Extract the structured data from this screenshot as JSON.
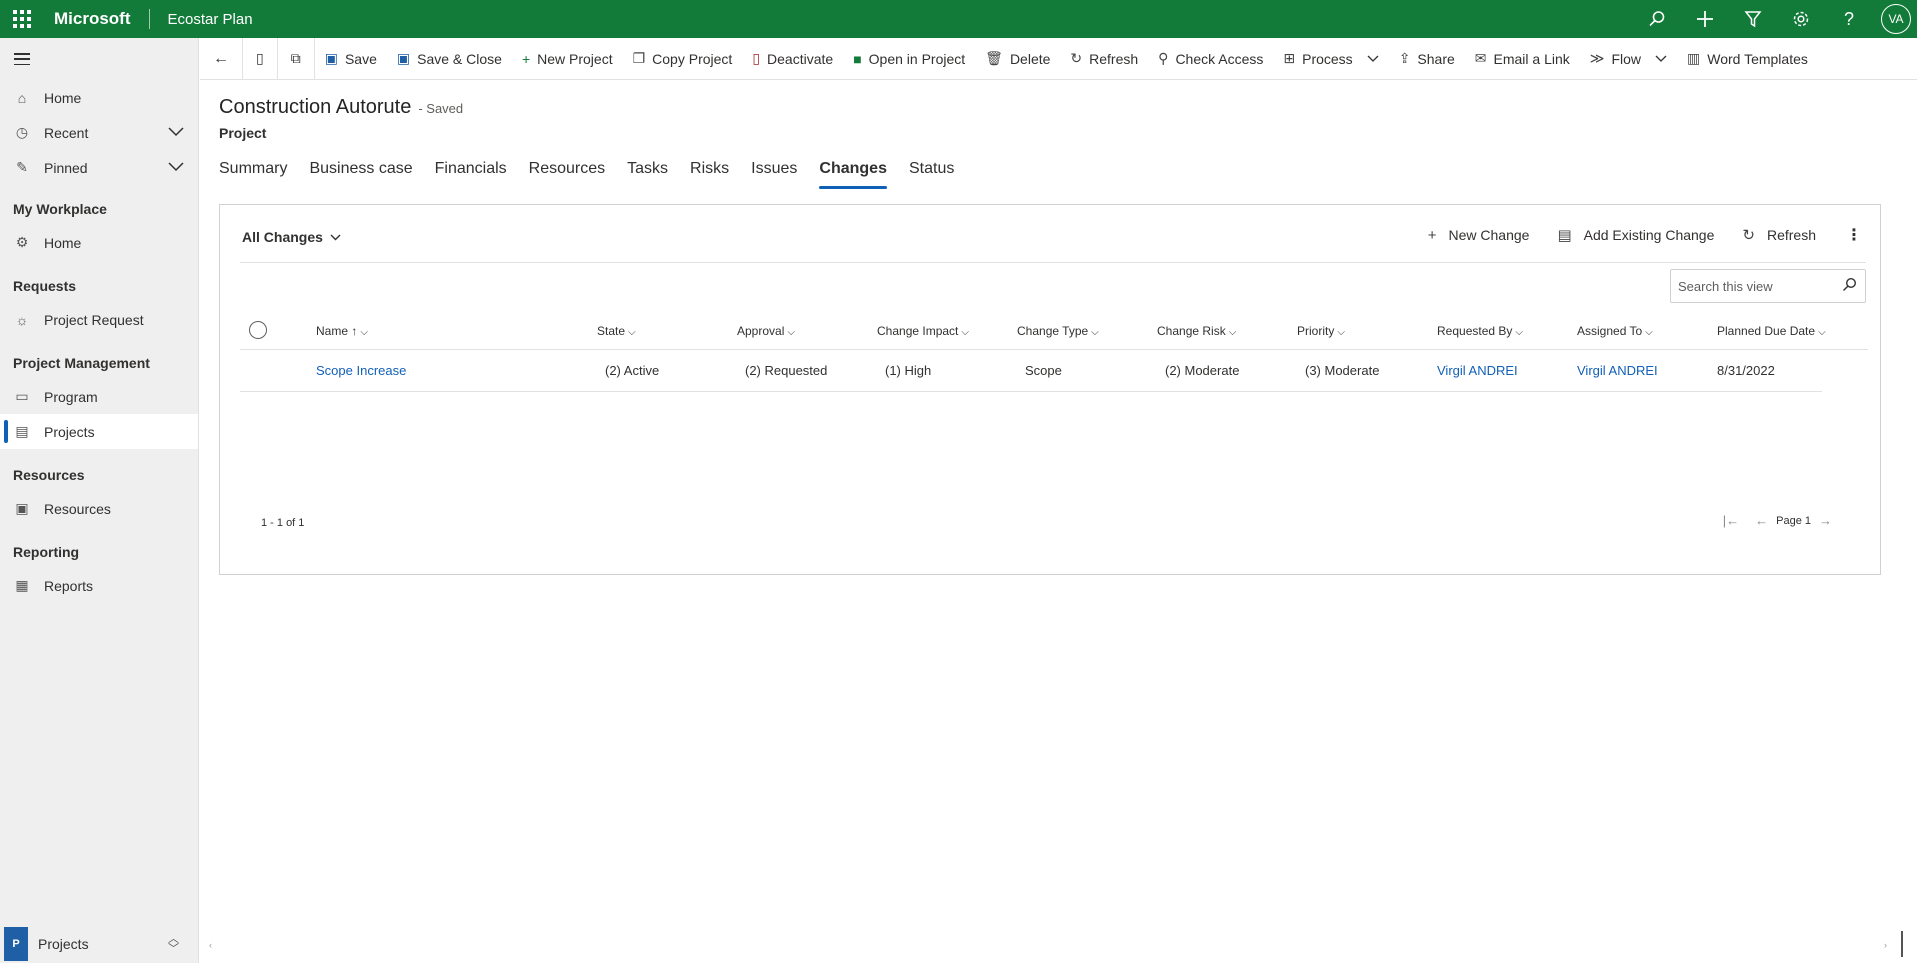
{
  "topbar": {
    "brand": "Microsoft",
    "app_name": "Ecostar Plan",
    "avatar_initials": "VA",
    "icons": [
      "search-icon",
      "plus-icon",
      "filter-icon",
      "gear-icon",
      "help-icon"
    ]
  },
  "sidebar": {
    "items_top": [
      {
        "label": "Home",
        "icon": "home-icon"
      },
      {
        "label": "Recent",
        "icon": "clock-icon",
        "expandable": true
      },
      {
        "label": "Pinned",
        "icon": "pin-icon",
        "expandable": true
      }
    ],
    "sections": [
      {
        "title": "My Workplace",
        "items": [
          {
            "label": "Home",
            "icon": "workplace-home-icon"
          }
        ]
      },
      {
        "title": "Requests",
        "items": [
          {
            "label": "Project Request",
            "icon": "request-icon"
          }
        ]
      },
      {
        "title": "Project Management",
        "items": [
          {
            "label": "Program",
            "icon": "laptop-icon"
          },
          {
            "label": "Projects",
            "icon": "projects-icon",
            "active": true
          }
        ]
      },
      {
        "title": "Resources",
        "items": [
          {
            "label": "Resources",
            "icon": "resources-icon"
          }
        ]
      },
      {
        "title": "Reporting",
        "items": [
          {
            "label": "Reports",
            "icon": "reports-icon"
          }
        ]
      }
    ],
    "bottom": {
      "badge": "P",
      "label": "Projects"
    }
  },
  "commands": [
    {
      "label": "Save",
      "icon": "save-icon"
    },
    {
      "label": "Save & Close",
      "icon": "save-close-icon"
    },
    {
      "label": "New Project",
      "icon": "plus-icon"
    },
    {
      "label": "Copy Project",
      "icon": "copy-icon"
    },
    {
      "label": "Deactivate",
      "icon": "deactivate-icon"
    },
    {
      "label": "Open in Project",
      "icon": "project-app-icon"
    },
    {
      "label": "Delete",
      "icon": "delete-icon"
    },
    {
      "label": "Refresh",
      "icon": "refresh-icon"
    },
    {
      "label": "Check Access",
      "icon": "check-access-icon"
    },
    {
      "label": "Process",
      "icon": "process-icon",
      "dropdown": true
    },
    {
      "label": "Share",
      "icon": "share-icon"
    },
    {
      "label": "Email a Link",
      "icon": "email-icon"
    },
    {
      "label": "Flow",
      "icon": "flow-icon",
      "dropdown": true
    },
    {
      "label": "Word Templates",
      "icon": "word-icon"
    }
  ],
  "record": {
    "title": "Construction Autorute",
    "status": "- Saved",
    "entity": "Project"
  },
  "tabs": [
    "Summary",
    "Business case",
    "Financials",
    "Resources",
    "Tasks",
    "Risks",
    "Issues",
    "Changes",
    "Status"
  ],
  "active_tab": "Changes",
  "subgrid": {
    "view_name": "All Changes",
    "commands": [
      {
        "label": "New Change",
        "icon": "plus-icon"
      },
      {
        "label": "Add Existing Change",
        "icon": "add-existing-icon"
      },
      {
        "label": "Refresh",
        "icon": "refresh-icon"
      }
    ],
    "search_placeholder": "Search this view",
    "columns": [
      "Name",
      "State",
      "Approval",
      "Change Impact",
      "Change Type",
      "Change Risk",
      "Priority",
      "Requested By",
      "Assigned To",
      "Planned Due Date"
    ],
    "sorted_column": "Name",
    "rows": [
      {
        "name": "Scope Increase",
        "state": "(2) Active",
        "approval": "(2) Requested",
        "change_impact": "(1) High",
        "change_type": "Scope",
        "change_risk": "(2) Moderate",
        "priority": "(3) Moderate",
        "requested_by": "Virgil ANDREI",
        "assigned_to": "Virgil ANDREI",
        "planned_due_date": "8/31/2022"
      }
    ],
    "record_count": "1 - 1 of 1",
    "page_label": "Page 1"
  },
  "colors": {
    "topbar": "#137b3a",
    "accent": "#1160b7",
    "sidebar_bg": "#efefef"
  }
}
